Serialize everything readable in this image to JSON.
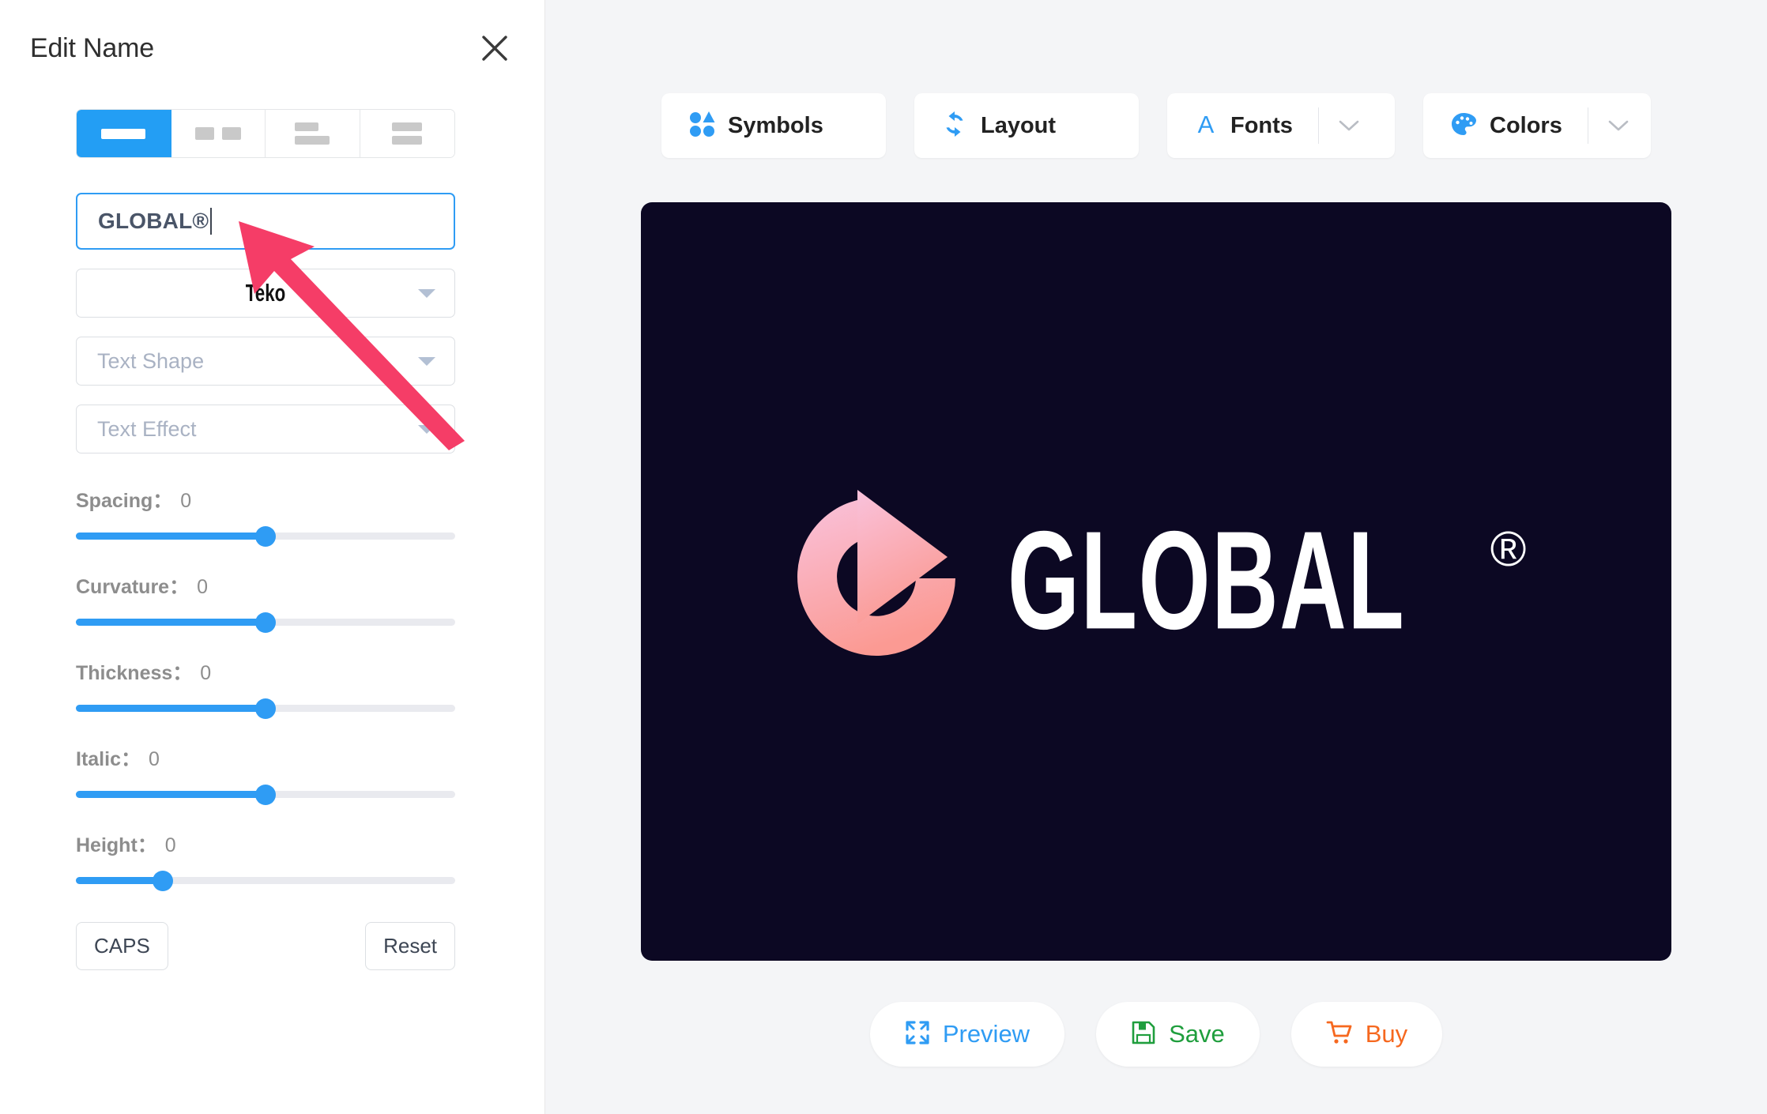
{
  "panel": {
    "title": "Edit Name",
    "close_icon": "close-icon",
    "layout_options": [
      {
        "name": "layout-single-line",
        "icon": "one-line-icon",
        "active": true
      },
      {
        "name": "layout-two-inline",
        "icon": "two-blocks-icon",
        "active": false
      },
      {
        "name": "layout-stacked-left",
        "icon": "stacked-left-icon",
        "active": false
      },
      {
        "name": "layout-stacked-equal",
        "icon": "stacked-equal-icon",
        "active": false
      }
    ],
    "name_input": {
      "value": "GLOBAL®",
      "placeholder": "Name"
    },
    "font_select": {
      "value": "Teko",
      "icon": "chevron-down-icon"
    },
    "shape_select": {
      "placeholder": "Text Shape",
      "value": "",
      "icon": "chevron-down-icon"
    },
    "effect_select": {
      "placeholder": "Text Effect",
      "value": "",
      "icon": "chevron-down-icon"
    },
    "sliders": [
      {
        "name": "spacing",
        "label": "Spacing",
        "separator": "：",
        "value": "0",
        "percent": 50
      },
      {
        "name": "curvature",
        "label": "Curvature",
        "separator": "：",
        "value": "0",
        "percent": 50
      },
      {
        "name": "thickness",
        "label": "Thickness",
        "separator": "：",
        "value": "0",
        "percent": 50
      },
      {
        "name": "italic",
        "label": "Italic",
        "separator": "：",
        "value": "0",
        "percent": 50
      },
      {
        "name": "height",
        "label": "Height",
        "separator": "：",
        "value": "0",
        "percent": 23
      }
    ],
    "caps_label": "CAPS",
    "reset_label": "Reset"
  },
  "toolbar": [
    {
      "name": "symbols",
      "label": "Symbols",
      "icon": "shapes-icon",
      "has_chevron": false
    },
    {
      "name": "layout",
      "label": "Layout",
      "icon": "refresh-icon",
      "has_chevron": false
    },
    {
      "name": "fonts",
      "label": "Fonts",
      "icon": "letter-a-icon",
      "has_chevron": true
    },
    {
      "name": "colors",
      "label": "Colors",
      "icon": "palette-icon",
      "has_chevron": true
    }
  ],
  "canvas": {
    "background": "#0c0823",
    "logo": {
      "symbol": "circular-arrow-play-icon",
      "gradient_start": "#f9c2dc",
      "gradient_end": "#fb9a93",
      "word": "GLOBAL",
      "registered_mark": "®",
      "text_color": "#ffffff"
    }
  },
  "actions": [
    {
      "name": "preview",
      "label": "Preview",
      "icon": "expand-icon",
      "color": "#2f9cf4"
    },
    {
      "name": "save",
      "label": "Save",
      "icon": "floppy-disk-icon",
      "color": "#1f9e3d"
    },
    {
      "name": "buy",
      "label": "Buy",
      "icon": "shopping-cart-icon",
      "color": "#f6681f"
    }
  ],
  "annotation": {
    "name": "pointer-arrow",
    "color": "#f53d67"
  }
}
